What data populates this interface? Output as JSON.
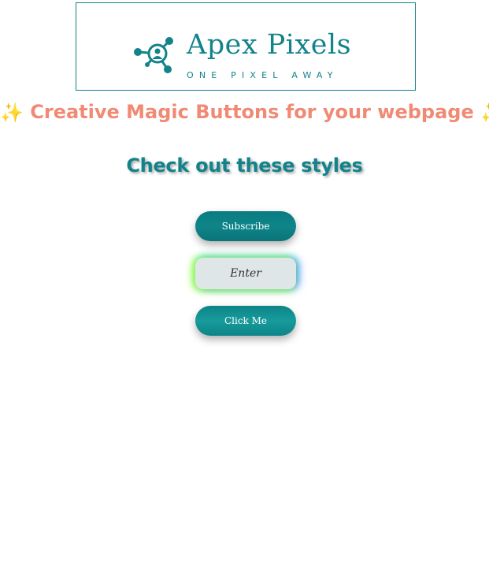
{
  "logo": {
    "name": "Apex Pixels",
    "tagline": "ONE PIXEL AWAY",
    "mark_icon": "network-person-icon"
  },
  "headline": {
    "sparkle_left": "✨",
    "text": "Creative Magic Buttons for your webpage",
    "sparkle_right": "✨"
  },
  "subhead": "Check out these styles",
  "buttons": {
    "subscribe": "Subscribe",
    "enter": "Enter",
    "click": "Click Me"
  },
  "colors": {
    "brand_teal": "#12838a",
    "headline_salmon": "#f08a74",
    "enter_background": "#dfe6e8"
  }
}
